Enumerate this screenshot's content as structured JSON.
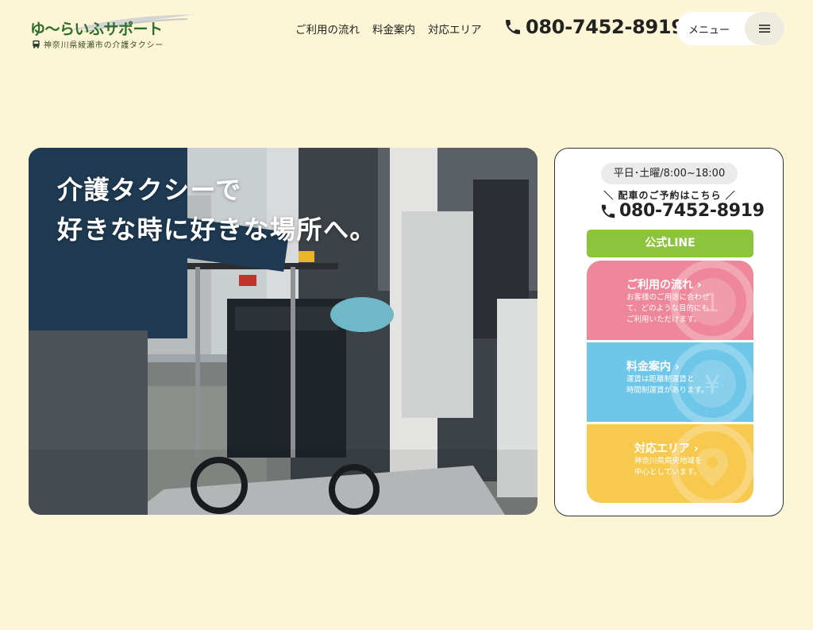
{
  "header": {
    "logo_title": "ゆ〜らいふサポート",
    "logo_subtitle": "神奈川県綾瀬市の介護タクシー",
    "nav": [
      "ご利用の流れ",
      "料金案内",
      "対応エリア"
    ],
    "phone": "080-7452-8919",
    "menu_label": "メニュー"
  },
  "hero": {
    "caption_line1": "介護タクシーで",
    "caption_line2": "好きな時に好きな場所へ。"
  },
  "card": {
    "hours": "平日･土曜/8:00~18:00",
    "booking_note": "＼ 配車のご予約はこちら ／",
    "phone": "080-7452-8919",
    "line_button": "公式LINE",
    "tiles": [
      {
        "title": "ご利用の流れ",
        "text": [
          "お客様のご用途に合わせ",
          "て、どのような目的にも",
          "ご利用いただけます。"
        ],
        "color": "#ee8799"
      },
      {
        "title": "料金案内",
        "text": [
          "運賃は距離制運賃と",
          "時間制運賃があります。"
        ],
        "color": "#6ec6e8"
      },
      {
        "title": "対応エリア",
        "text": [
          "神奈川県県央地域を",
          "中心としています。"
        ],
        "color": "#f7c94f"
      }
    ]
  },
  "colors": {
    "background": "#fdf6d6",
    "line_green": "#8cc43c",
    "logo_green": "#2f6b2c"
  },
  "icons": [
    "bus-icon",
    "phone-icon",
    "hamburger-icon",
    "chevron-right-icon",
    "yen-icon",
    "map-pin-icon"
  ]
}
